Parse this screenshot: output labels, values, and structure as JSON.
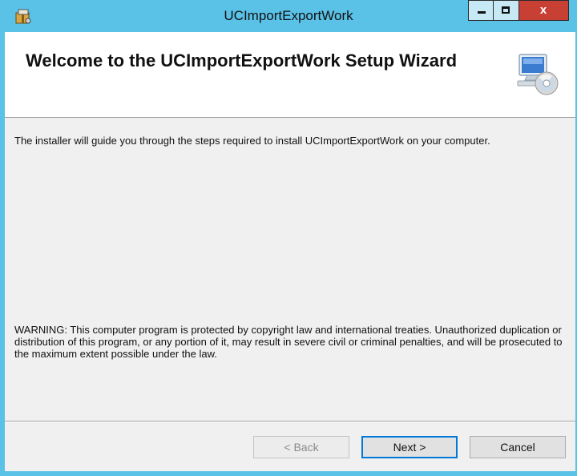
{
  "window": {
    "title": "UCImportExportWork",
    "close_glyph": "x"
  },
  "banner": {
    "title": "Welcome to the UCImportExportWork Setup Wizard",
    "icon": "computer-cd-icon"
  },
  "body": {
    "intro": "The installer will guide you through the steps required to install UCImportExportWork on your computer.",
    "warning": "WARNING: This computer program is protected by copyright law and international treaties. Unauthorized duplication or distribution of this program, or any portion of it, may result in severe civil or criminal penalties, and will be prosecuted to the maximum extent possible under the law."
  },
  "buttons": {
    "back": "< Back",
    "next": "Next >",
    "cancel": "Cancel"
  },
  "colors": {
    "titlebar": "#5ac1e7",
    "close": "#c83f34",
    "focus": "#0078d7"
  }
}
